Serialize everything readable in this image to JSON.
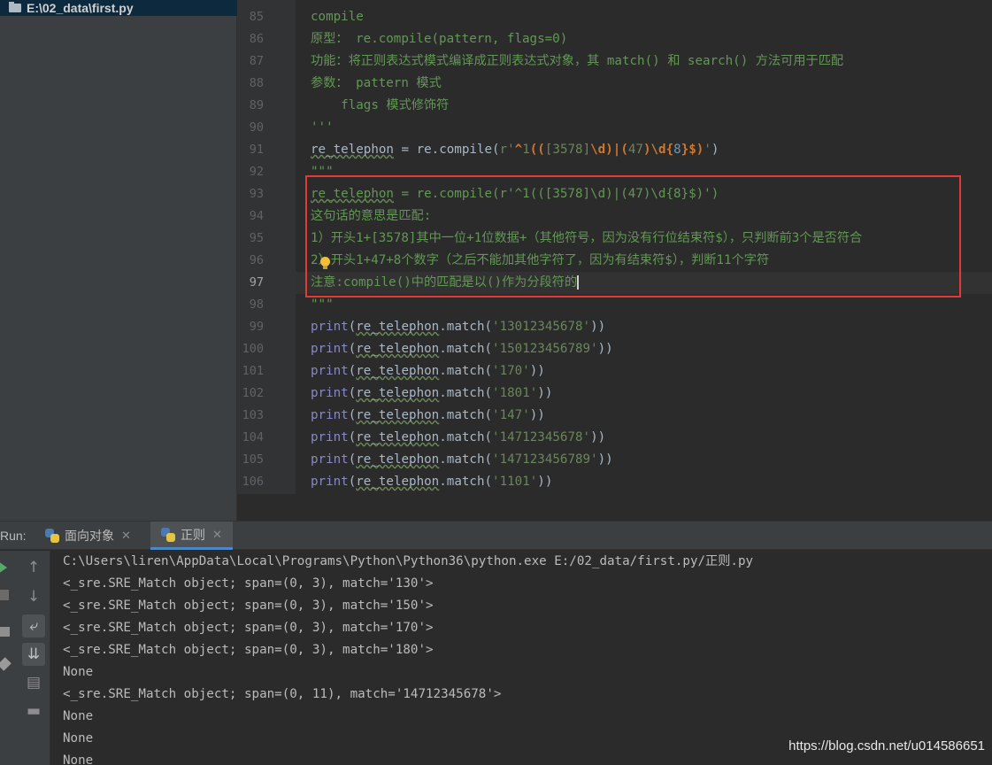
{
  "project_tree": {
    "path_label": "E:\\02_data\\first.py"
  },
  "editor": {
    "line_numbers": [
      "85",
      "86",
      "87",
      "88",
      "89",
      "90",
      "91",
      "92",
      "93",
      "94",
      "95",
      "96",
      "97",
      "98",
      "99",
      "100",
      "101",
      "102",
      "103",
      "104",
      "105",
      "106"
    ],
    "current_line": "97",
    "lines": [
      "compile",
      "原型： re.compile(pattern, flags=0)",
      "功能：将正则表达式模式编译成正则表达式对象，其 match() 和 search() 方法可用于匹配",
      "参数： pattern 模式",
      "    flags 模式修饰符",
      "'''",
      "re_telephon = re.compile(r'^1(([3578]\\d)|(47)\\d{8}$)')",
      "\"\"\"",
      "re_telephon = re.compile(r'^1(([3578]\\d)|(47)\\d{8}$)')",
      "这句话的意思是匹配:",
      "1）开头1+[3578]其中一位+1位数据+（其他符号，因为没有行位结束符$），只判断前3个是否符合",
      "2）开头1+47+8个数字（之后不能加其他字符了，因为有结束符$），判断11个字符",
      "注意:compile()中的匹配是以()作为分段符的",
      "\"\"\"",
      "print(re_telephon.match('13012345678'))",
      "print(re_telephon.match('150123456789'))",
      "print(re_telephon.match('170'))",
      "print(re_telephon.match('1801'))",
      "print(re_telephon.match('147'))",
      "print(re_telephon.match('14712345678'))",
      "print(re_telephon.match('147123456789'))",
      "print(re_telephon.match('1101'))"
    ]
  },
  "run_panel": {
    "label": "Run:",
    "tabs": [
      {
        "label": "面向对象"
      },
      {
        "label": "正则"
      }
    ],
    "close_glyph": "✕",
    "output": [
      "C:\\Users\\liren\\AppData\\Local\\Programs\\Python\\Python36\\python.exe E:/02_data/first.py/正则.py",
      "<_sre.SRE_Match object; span=(0, 3), match='130'>",
      "<_sre.SRE_Match object; span=(0, 3), match='150'>",
      "<_sre.SRE_Match object; span=(0, 3), match='170'>",
      "<_sre.SRE_Match object; span=(0, 3), match='180'>",
      "None",
      "<_sre.SRE_Match object; span=(0, 11), match='14712345678'>",
      "None",
      "None",
      "None"
    ]
  },
  "icons": {
    "rerun": "play-icon",
    "stop": "stop-icon",
    "up": "arrow-up-icon",
    "down": "arrow-down-icon",
    "wrap": "soft-wrap-icon",
    "scroll": "scroll-to-end-icon",
    "print": "print-icon",
    "trash": "trash-icon",
    "pin": "pin-icon"
  },
  "colors": {
    "keyword": "#cc7832",
    "string": "#6a8759",
    "docstring": "#629755",
    "number": "#6897bb",
    "highlight_box": "#e53935"
  },
  "watermark": "https://blog.csdn.net/u014586651"
}
